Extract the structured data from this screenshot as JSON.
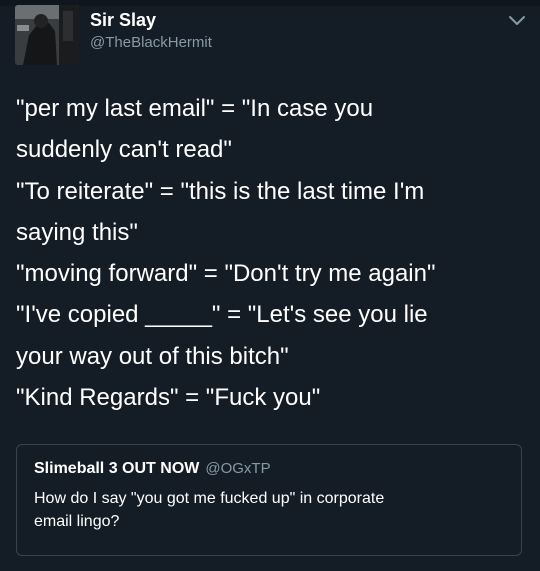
{
  "tweet": {
    "author": {
      "display_name": "Sir Slay",
      "handle": "@TheBlackHermit"
    },
    "menu_icon": "chevron-down-icon",
    "lines": [
      "\"per my last email\" = \"In case you",
      "suddenly can't read\"",
      "\"To reiterate\" = \"this is the last time I'm",
      "saying this\"",
      "\"moving forward\" = \"Don't try me again\"",
      "\"I've copied _____\" = \"Let's see you lie",
      "your way out of this bitch\"",
      "\"Kind Regards\" = \"Fuck you\""
    ]
  },
  "quoted_tweet": {
    "display_name": "Slimeball 3 OUT NOW",
    "handle": "@OGxTP",
    "lines": [
      "How do I say \"you got me fucked up\" in corporate",
      "email lingo?"
    ]
  },
  "colors": {
    "background": "#141d26",
    "text": "#ffffff",
    "secondary_text": "#8899a6",
    "card_border": "#38444d"
  }
}
